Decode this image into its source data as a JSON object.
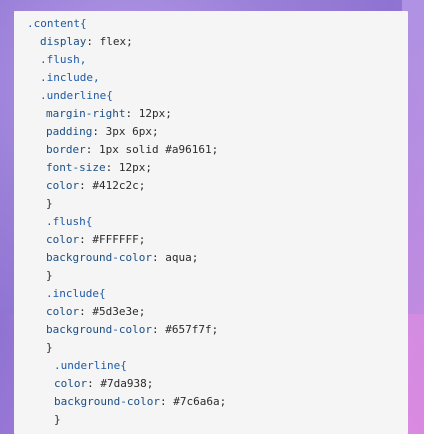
{
  "code": {
    "lines": [
      {
        "indent": 0,
        "kind": "selector",
        "text": ".content{"
      },
      {
        "indent": 1,
        "kind": "decl",
        "prop": "display",
        "value": "flex;"
      },
      {
        "indent": 1,
        "kind": "selector",
        "text": ".flush,"
      },
      {
        "indent": 1,
        "kind": "selector",
        "text": ".include,"
      },
      {
        "indent": 1,
        "kind": "selector",
        "text": ".underline{"
      },
      {
        "indent": 2,
        "kind": "decl",
        "prop": "margin-right",
        "value": "12px;"
      },
      {
        "indent": 2,
        "kind": "decl",
        "prop": "padding",
        "value": "3px 6px;"
      },
      {
        "indent": 2,
        "kind": "decl",
        "prop": "border",
        "value": "1px solid #a96161;"
      },
      {
        "indent": 2,
        "kind": "decl",
        "prop": "font-size",
        "value": "12px;"
      },
      {
        "indent": 2,
        "kind": "decl",
        "prop": "color",
        "value": "#412c2c;"
      },
      {
        "indent": 2,
        "kind": "punc",
        "text": "}"
      },
      {
        "indent": 2,
        "kind": "selector",
        "text": ".flush{"
      },
      {
        "indent": 2,
        "kind": "decl",
        "prop": "color",
        "value": "#FFFFFF;"
      },
      {
        "indent": 2,
        "kind": "decl",
        "prop": "background-color",
        "value": "aqua;"
      },
      {
        "indent": 2,
        "kind": "punc",
        "text": "}"
      },
      {
        "indent": 2,
        "kind": "selector",
        "text": ".include{"
      },
      {
        "indent": 2,
        "kind": "decl",
        "prop": "color",
        "value": "#5d3e3e;"
      },
      {
        "indent": 2,
        "kind": "decl",
        "prop": "background-color",
        "value": "#657f7f;"
      },
      {
        "indent": 2,
        "kind": "punc",
        "text": "}"
      },
      {
        "indent": 3,
        "kind": "selector",
        "text": ".underline{"
      },
      {
        "indent": 3,
        "kind": "decl",
        "prop": "color",
        "value": "#7da938;"
      },
      {
        "indent": 3,
        "kind": "decl",
        "prop": "background-color",
        "value": "#7c6a6a;"
      },
      {
        "indent": 3,
        "kind": "punc",
        "text": "}"
      }
    ]
  },
  "colors": {
    "selector": "#1e5aa8",
    "property": "#1b4f86",
    "value": "#2b2b2b",
    "card_background": "#f5f5f5"
  }
}
